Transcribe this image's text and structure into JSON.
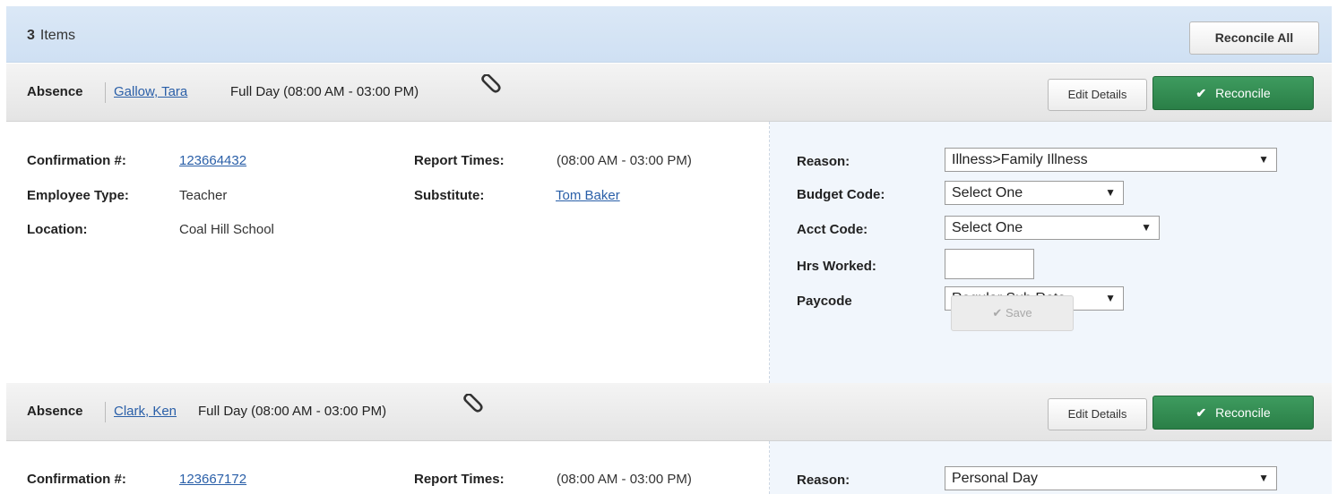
{
  "toolbar": {
    "count": "3",
    "count_label": "Items",
    "reconcile_all_label": "Reconcile All"
  },
  "records": [
    {
      "type": "Absence",
      "employee": "Gallow, Tara",
      "time": "Full Day (08:00 AM - 03:00 PM)",
      "edit_label": "Edit Details",
      "reconcile_label": "Reconcile",
      "confirmation_label": "Confirmation #:",
      "confirmation": "123664432",
      "report_times_label": "Report Times:",
      "report_times": "(08:00 AM - 03:00 PM)",
      "employee_type_label": "Employee Type:",
      "employee_type": "Teacher",
      "substitute_label": "Substitute:",
      "substitute": "Tom Baker",
      "location_label": "Location:",
      "location": "Coal Hill School",
      "reason_label": "Reason:",
      "reason": "Illness>Family Illness",
      "budget_code_label": "Budget Code:",
      "budget_code": "Select One",
      "acct_code_label": "Acct Code:",
      "acct_code": "Select One",
      "hrs_worked_label": "Hrs Worked:",
      "hrs_worked": "",
      "paycode_label": "Paycode",
      "paycode": "Regular Sub Rate",
      "save_label": "Save"
    },
    {
      "type": "Absence",
      "employee": "Clark, Ken",
      "time": "Full Day (08:00 AM - 03:00 PM)",
      "edit_label": "Edit Details",
      "reconcile_label": "Reconcile",
      "confirmation_label": "Confirmation #:",
      "confirmation": "123667172",
      "report_times_label": "Report Times:",
      "report_times": "(08:00 AM - 03:00 PM)",
      "reason_label": "Reason:",
      "reason": "Personal Day"
    }
  ],
  "colors": {
    "accent_green": "#2e8b4f",
    "link_blue": "#2a5fa8",
    "topbar_blue": "#d6e5f5"
  }
}
